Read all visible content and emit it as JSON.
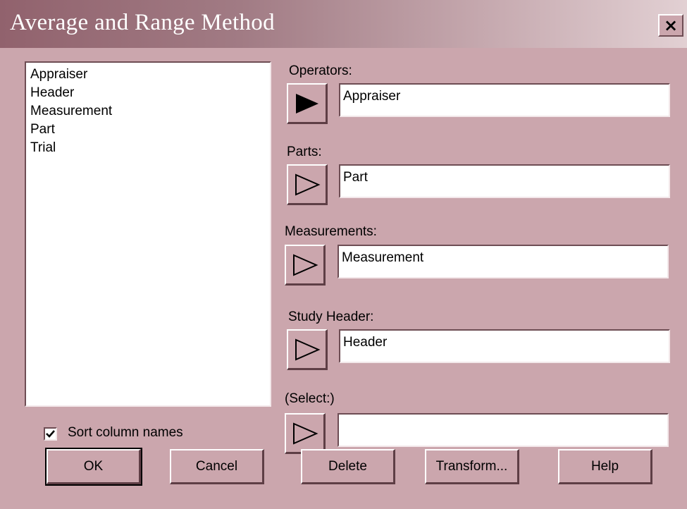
{
  "window": {
    "title": "Average and Range Method",
    "close_label": "×"
  },
  "columns": {
    "items": [
      "Appraiser",
      "Header",
      "Measurement",
      "Part",
      "Trial"
    ]
  },
  "fields": {
    "operators": {
      "label": "Operators:",
      "value": "Appraiser",
      "arrow_state": "filled"
    },
    "parts": {
      "label": "Parts:",
      "value": "Part",
      "arrow_state": "outline"
    },
    "measurements": {
      "label": "Measurements:",
      "value": "Measurement",
      "arrow_state": "outline"
    },
    "study_header": {
      "label": "Study Header:",
      "value": "Header",
      "arrow_state": "outline"
    },
    "select": {
      "label": "(Select:)",
      "value": "",
      "arrow_state": "outline"
    }
  },
  "sort": {
    "label": "Sort column names",
    "checked": true
  },
  "buttons": {
    "ok": "OK",
    "cancel": "Cancel",
    "delete": "Delete",
    "transform": "Transform...",
    "help": "Help"
  },
  "colors": {
    "dialog_bg": "#cba6ad",
    "title_dark": "#91626d"
  }
}
